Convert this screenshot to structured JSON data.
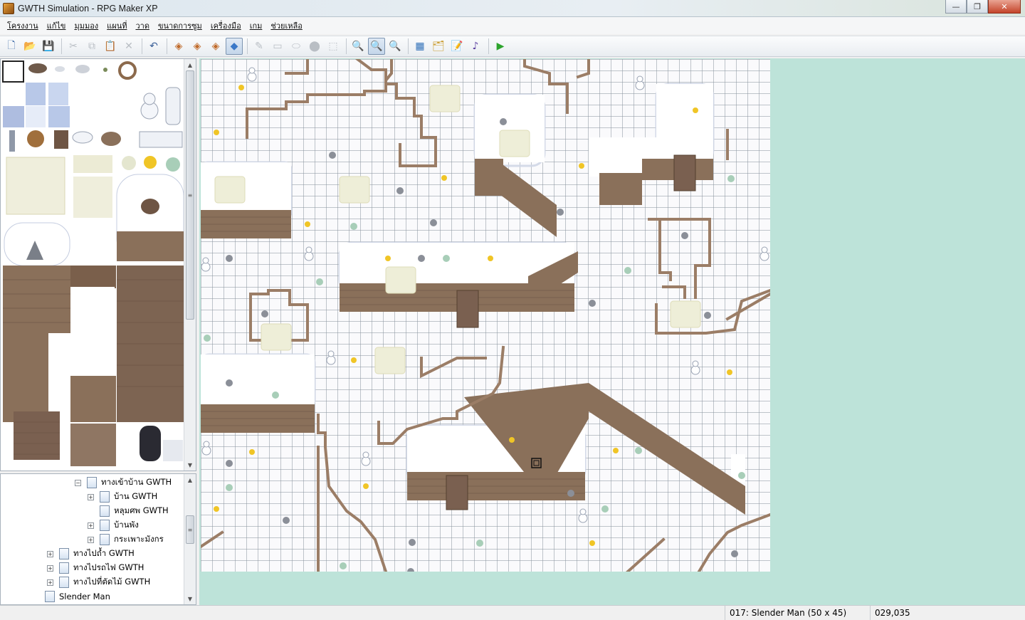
{
  "window": {
    "title": "GWTH Simulation - RPG Maker XP",
    "minimize": "—",
    "maximize": "❐",
    "close": "✕"
  },
  "menu": [
    {
      "id": "project",
      "label": "โครงงาน"
    },
    {
      "id": "edit",
      "label": "แก้ไข"
    },
    {
      "id": "view",
      "label": "มุมมอง"
    },
    {
      "id": "mode",
      "label": "แผนที่"
    },
    {
      "id": "draw",
      "label": "วาด"
    },
    {
      "id": "scale",
      "label": "ขนาดการซูม"
    },
    {
      "id": "tools",
      "label": "เครื่องมือ"
    },
    {
      "id": "game",
      "label": "เกม"
    },
    {
      "id": "help",
      "label": "ช่วยเหลือ"
    }
  ],
  "toolbar": {
    "new": "🗋",
    "open": "📂",
    "save": "💾",
    "cut": "✂",
    "copy": "⧉",
    "paste": "📋",
    "delete": "✕",
    "undo": "↶",
    "layer1": "◈",
    "layer2": "◈",
    "layer3": "◈",
    "events": "◆",
    "pencil": "✎",
    "rectangle": "▭",
    "ellipse": "⬭",
    "flood": "⬤",
    "select": "⬚",
    "zoom_1_1": "🔍",
    "zoom_1_2": "🔍",
    "zoom_1_4": "🔍",
    "database": "▦",
    "materials": "🗂",
    "script": "📝",
    "sound": "♪",
    "playtest": "▶"
  },
  "tree": [
    {
      "label": "ทางเข้าบ้าน GWTH",
      "level": 2,
      "expander": "−"
    },
    {
      "label": "บ้าน GWTH",
      "level": 3,
      "expander": "+"
    },
    {
      "label": "หลุมศพ GWTH",
      "level": 3,
      "expander": ""
    },
    {
      "label": "บ้านพัง",
      "level": 3,
      "expander": "+"
    },
    {
      "label": "กระเพาะมังกร",
      "level": 3,
      "expander": "+"
    },
    {
      "label": "ทางไปถ้ำ GWTH",
      "level": 1,
      "expander": "+"
    },
    {
      "label": "ทางไปรถไฟ GWTH",
      "level": 1,
      "expander": "+"
    },
    {
      "label": "ทางไปที่ตัดไม้ GWTH",
      "level": 1,
      "expander": "+"
    },
    {
      "label": "Slender Man",
      "level": 0,
      "expander": ""
    }
  ],
  "status": {
    "map_info": "017: Slender Man (50 x 45)",
    "coordinates": "029,035"
  },
  "colors": {
    "map_background": "#bde3d9",
    "snow": "#fafafc",
    "cliff": "#8a705a",
    "path": "#9b7d66"
  }
}
